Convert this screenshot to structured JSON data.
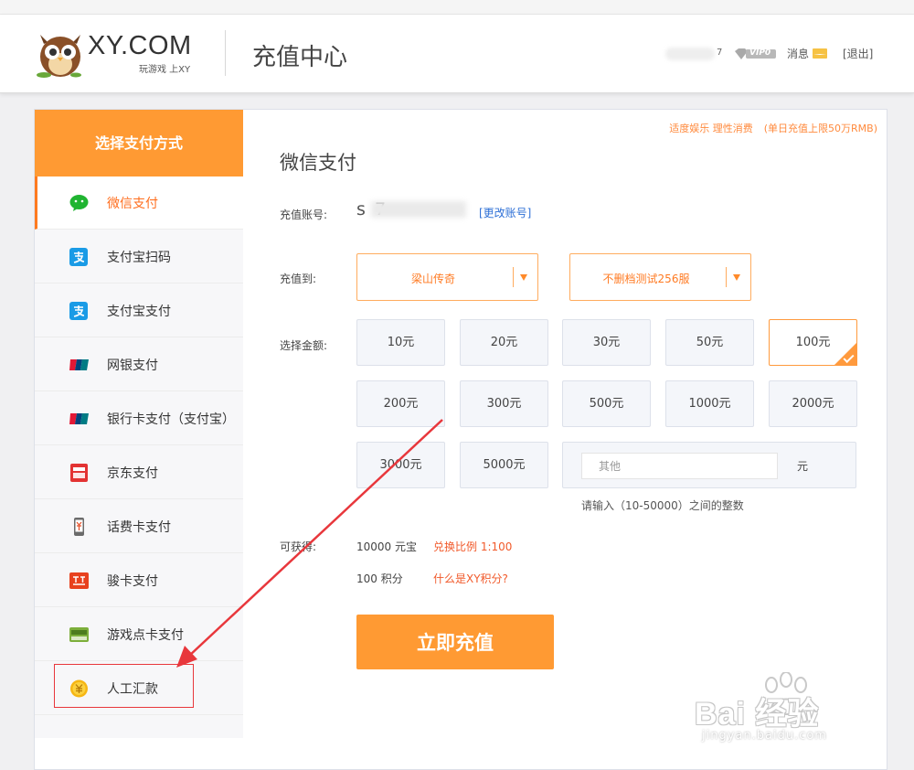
{
  "header": {
    "logo_text": "XY.COM",
    "logo_slogan": "玩游戏 上XY",
    "page_title": "充值中心",
    "user_tail": "7",
    "vip_label": "VIP0",
    "message_label": "消息",
    "logout_label": "[退出]"
  },
  "sidebar": {
    "title": "选择支付方式",
    "items": [
      {
        "label": "微信支付",
        "icon": "wechat-icon"
      },
      {
        "label": "支付宝扫码",
        "icon": "alipay-icon"
      },
      {
        "label": "支付宝支付",
        "icon": "alipay-icon"
      },
      {
        "label": "网银支付",
        "icon": "unionpay-icon"
      },
      {
        "label": "银行卡支付（支付宝）",
        "icon": "unionpay-icon"
      },
      {
        "label": "京东支付",
        "icon": "jd-pay-icon"
      },
      {
        "label": "话费卡支付",
        "icon": "phone-card-icon"
      },
      {
        "label": "骏卡支付",
        "icon": "jcard-icon"
      },
      {
        "label": "游戏点卡支付",
        "icon": "game-card-icon"
      },
      {
        "label": "人工汇款",
        "icon": "coin-icon"
      }
    ],
    "active_index": 0
  },
  "main": {
    "limit_note_1": "适度娱乐 理性消费",
    "limit_note_2": "(单日充值上限50万RMB)",
    "section_title": "微信支付",
    "account_label": "充值账号:",
    "account_value": "s              7",
    "change_account": "[更改账号]",
    "recharge_to_label": "充值到:",
    "game_select": "梁山传奇",
    "server_select": "不删档测试256服",
    "amount_label": "选择金额:",
    "amounts": [
      "10元",
      "20元",
      "30元",
      "50元",
      "100元",
      "200元",
      "300元",
      "500元",
      "1000元",
      "2000元",
      "3000元",
      "5000元"
    ],
    "selected_amount": "100元",
    "other_placeholder": "其他",
    "other_unit": "元",
    "hint": "请输入（10-50000）之间的整数",
    "gain_label": "可获得:",
    "gain_yuanbao": "10000 元宝",
    "exchange_ratio": "兑换比例 1:100",
    "gain_points": "100 积分",
    "points_link": "什么是XY积分?",
    "submit_label": "立即充值"
  },
  "watermark": {
    "main": "Bai 经验",
    "url": "jingyan.baidu.com"
  },
  "colors": {
    "accent": "#ff9a33",
    "active_text": "#ff6e1e",
    "link_blue": "#2d6fd6",
    "link_red": "#f15a2b",
    "annotation_red": "#e8373c"
  }
}
